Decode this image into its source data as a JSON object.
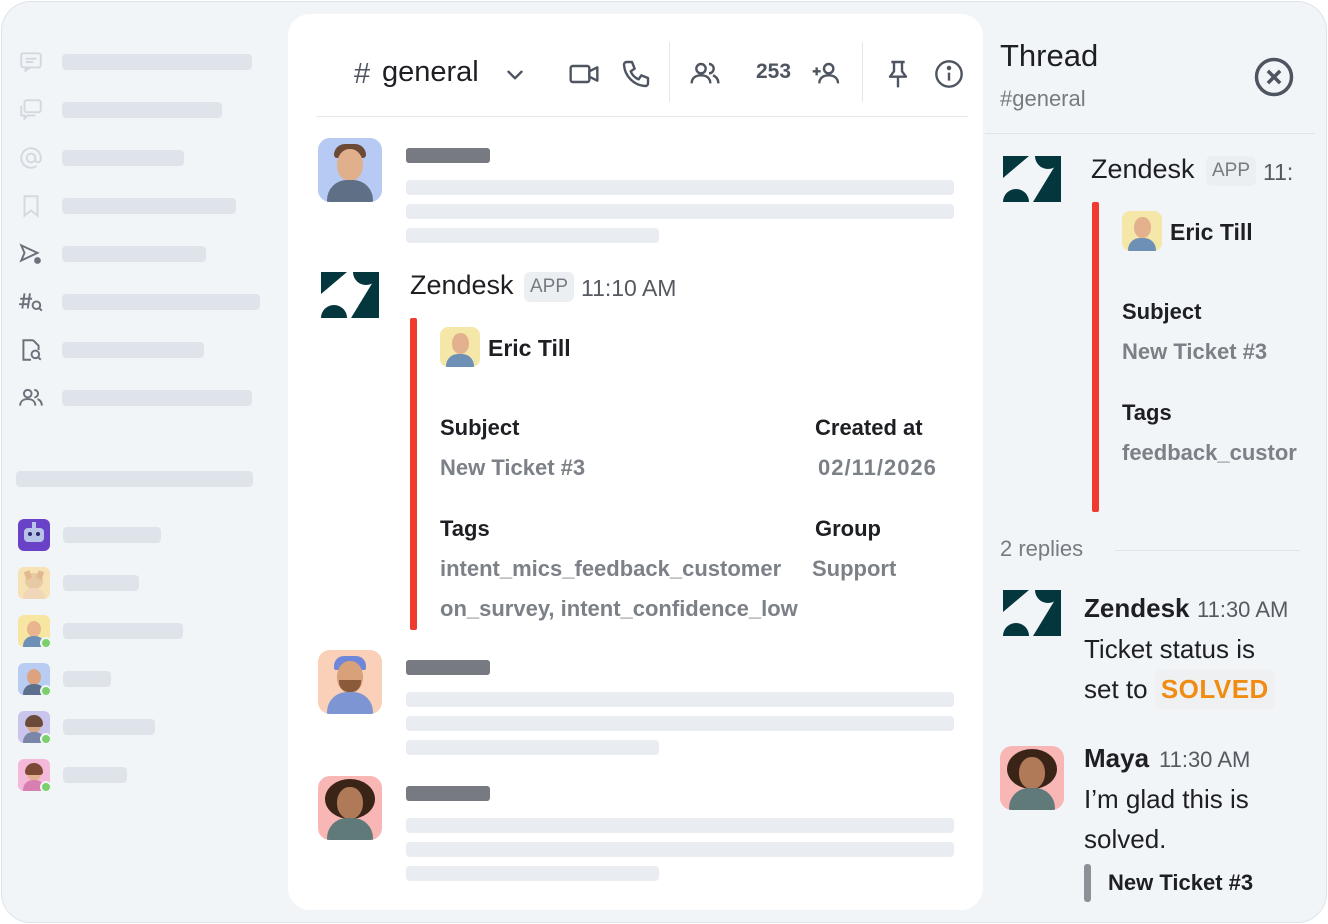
{
  "channel": {
    "hash": "#",
    "name": "general",
    "member_count": "253"
  },
  "message": {
    "app_name": "Zendesk",
    "badge": "APP",
    "time": "11:10 AM",
    "card": {
      "requester": "Eric Till",
      "subject_label": "Subject",
      "subject_value": "New Ticket #3",
      "created_label": "Created at",
      "created_value": "02/11/2026",
      "tags_label": "Tags",
      "tags_line1": "intent_mics_feedback_customer",
      "tags_line2": "on_survey, intent_confidence_low",
      "group_label": "Group",
      "group_value": "Support"
    }
  },
  "thread": {
    "title": "Thread",
    "channel": "#general",
    "parent": {
      "app_name": "Zendesk",
      "badge": "APP",
      "time": "11:",
      "requester": "Eric Till",
      "subject_label": "Subject",
      "subject_value": "New Ticket #3",
      "tags_label": "Tags",
      "tags_value": "feedback_custor"
    },
    "replies_count": "2 replies",
    "replies": [
      {
        "name": "Zendesk",
        "time": "11:30 AM",
        "text_line1": "Ticket status is",
        "text_line2": "set to",
        "status": "SOLVED"
      },
      {
        "name": "Maya",
        "time": "11:30 AM",
        "text_line1": "I’m glad this is",
        "text_line2": "solved.",
        "quote": "New Ticket #3"
      }
    ]
  },
  "icons": {
    "sidebar": [
      "threads-icon",
      "messages-icon",
      "mentions-icon",
      "saved-icon",
      "scheduled-icon",
      "channel-search-icon",
      "file-search-icon",
      "people-icon"
    ],
    "header": [
      "chevron-down-icon",
      "video-call-icon",
      "phone-call-icon",
      "members-icon",
      "add-member-icon",
      "pin-icon",
      "info-icon"
    ]
  },
  "colors": {
    "accent_red": "#f03a2e",
    "status_orange": "#f08c12",
    "zendesk_green": "#03363d",
    "online_green": "#7bd06b"
  }
}
